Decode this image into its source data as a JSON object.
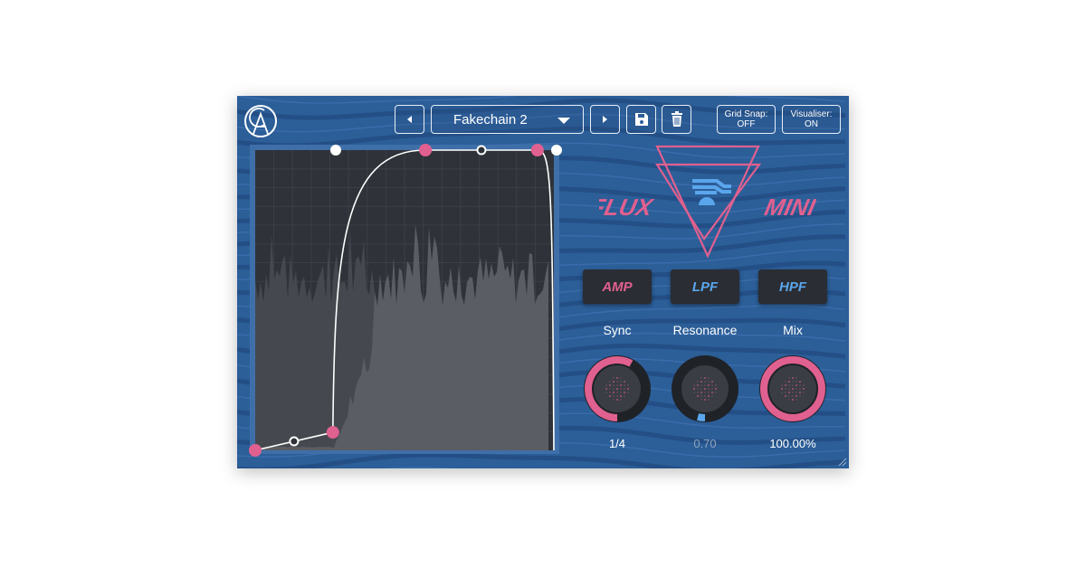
{
  "header": {
    "preset_name": "Fakechain 2",
    "prev_icon": "triangle-left-icon",
    "next_icon": "triangle-right-icon",
    "dropdown_icon": "caret-down-icon",
    "save_icon": "floppy-disk-icon",
    "delete_icon": "trash-icon",
    "grid_snap_label": "Grid Snap:",
    "grid_snap_value": "OFF",
    "visualiser_label": "Visualiser:",
    "visualiser_value": "ON"
  },
  "logo": {
    "brand_text": "FLUX MINI",
    "left_word": "FLUX",
    "right_word": "MINI"
  },
  "modes": [
    {
      "label": "AMP",
      "active": true
    },
    {
      "label": "LPF",
      "active": false
    },
    {
      "label": "HPF",
      "active": false
    }
  ],
  "knobs": [
    {
      "label": "Sync",
      "value": "1/4",
      "level": 0.58,
      "color": "#e0608f",
      "enabled": true
    },
    {
      "label": "Resonance",
      "value": "0.70",
      "level": 0.04,
      "color": "#5aa6ec",
      "enabled": false
    },
    {
      "label": "Mix",
      "value": "100.00%",
      "level": 1.0,
      "color": "#e0608f",
      "enabled": true
    }
  ],
  "envelope": {
    "points": [
      [
        0,
        0
      ],
      [
        0.26,
        0.06
      ],
      [
        0.57,
        1
      ],
      [
        0.945,
        1
      ],
      [
        1,
        0
      ]
    ]
  },
  "colors": {
    "background": "#2c5e98",
    "accent_pink": "#e0608f",
    "accent_blue": "#5aa6ec",
    "graph_bg": "#2f3238"
  }
}
